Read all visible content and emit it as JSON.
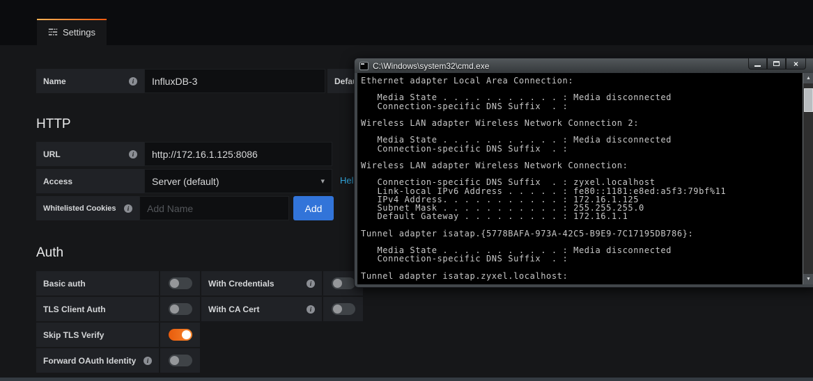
{
  "tab": {
    "label": "Settings"
  },
  "icons": {
    "info": "i",
    "caret_down": "▾",
    "close": "×",
    "arrow_up": "▲",
    "arrow_down": "▼"
  },
  "form": {
    "name": {
      "label": "Name",
      "value": "InfluxDB-3"
    },
    "default": {
      "label": "Default"
    },
    "http": {
      "heading": "HTTP",
      "url": {
        "label": "URL",
        "value": "http://172.16.1.125:8086"
      },
      "access": {
        "label": "Access",
        "value": "Server (default)",
        "help_label": "Help"
      },
      "cookies": {
        "label": "Whitelisted Cookies",
        "placeholder": "Add Name",
        "add_label": "Add"
      }
    },
    "auth": {
      "heading": "Auth",
      "switches": [
        {
          "label": "Basic auth",
          "on": false
        },
        {
          "label": "With Credentials",
          "on": false
        },
        {
          "label": "TLS Client Auth",
          "on": false
        },
        {
          "label": "With CA Cert",
          "on": false
        },
        {
          "label": "Skip TLS Verify",
          "on": true
        },
        {
          "label": "Forward OAuth Identity",
          "on": false
        }
      ]
    }
  },
  "cmd": {
    "title": "C:\\Windows\\system32\\cmd.exe",
    "console_lines": [
      "Ethernet adapter Local Area Connection:",
      "",
      "   Media State . . . . . . . . . . . : Media disconnected",
      "   Connection-specific DNS Suffix  . :",
      "",
      "Wireless LAN adapter Wireless Network Connection 2:",
      "",
      "   Media State . . . . . . . . . . . : Media disconnected",
      "   Connection-specific DNS Suffix  . :",
      "",
      "Wireless LAN adapter Wireless Network Connection:",
      "",
      "   Connection-specific DNS Suffix  . : zyxel.localhost",
      "   Link-local IPv6 Address . . . . . : fe80::1181:e8ed:a5f3:79bf%11",
      "   IPv4 Address. . . . . . . . . . . : 172.16.1.125",
      "   Subnet Mask . . . . . . . . . . . : 255.255.255.0",
      "   Default Gateway . . . . . . . . . : 172.16.1.1",
      "",
      "Tunnel adapter isatap.{5778BAFA-973A-42C5-B9E9-7C17195DB786}:",
      "",
      "   Media State . . . . . . . . . . . : Media disconnected",
      "   Connection-specific DNS Suffix  . :",
      "",
      "Tunnel adapter isatap.zyxel.localhost:"
    ]
  },
  "colors": {
    "accent_orange": "#f0590e",
    "button_blue": "#3274d9",
    "link_blue": "#33a9e0",
    "background": "#161719",
    "header_background": "#0b0c0e"
  }
}
